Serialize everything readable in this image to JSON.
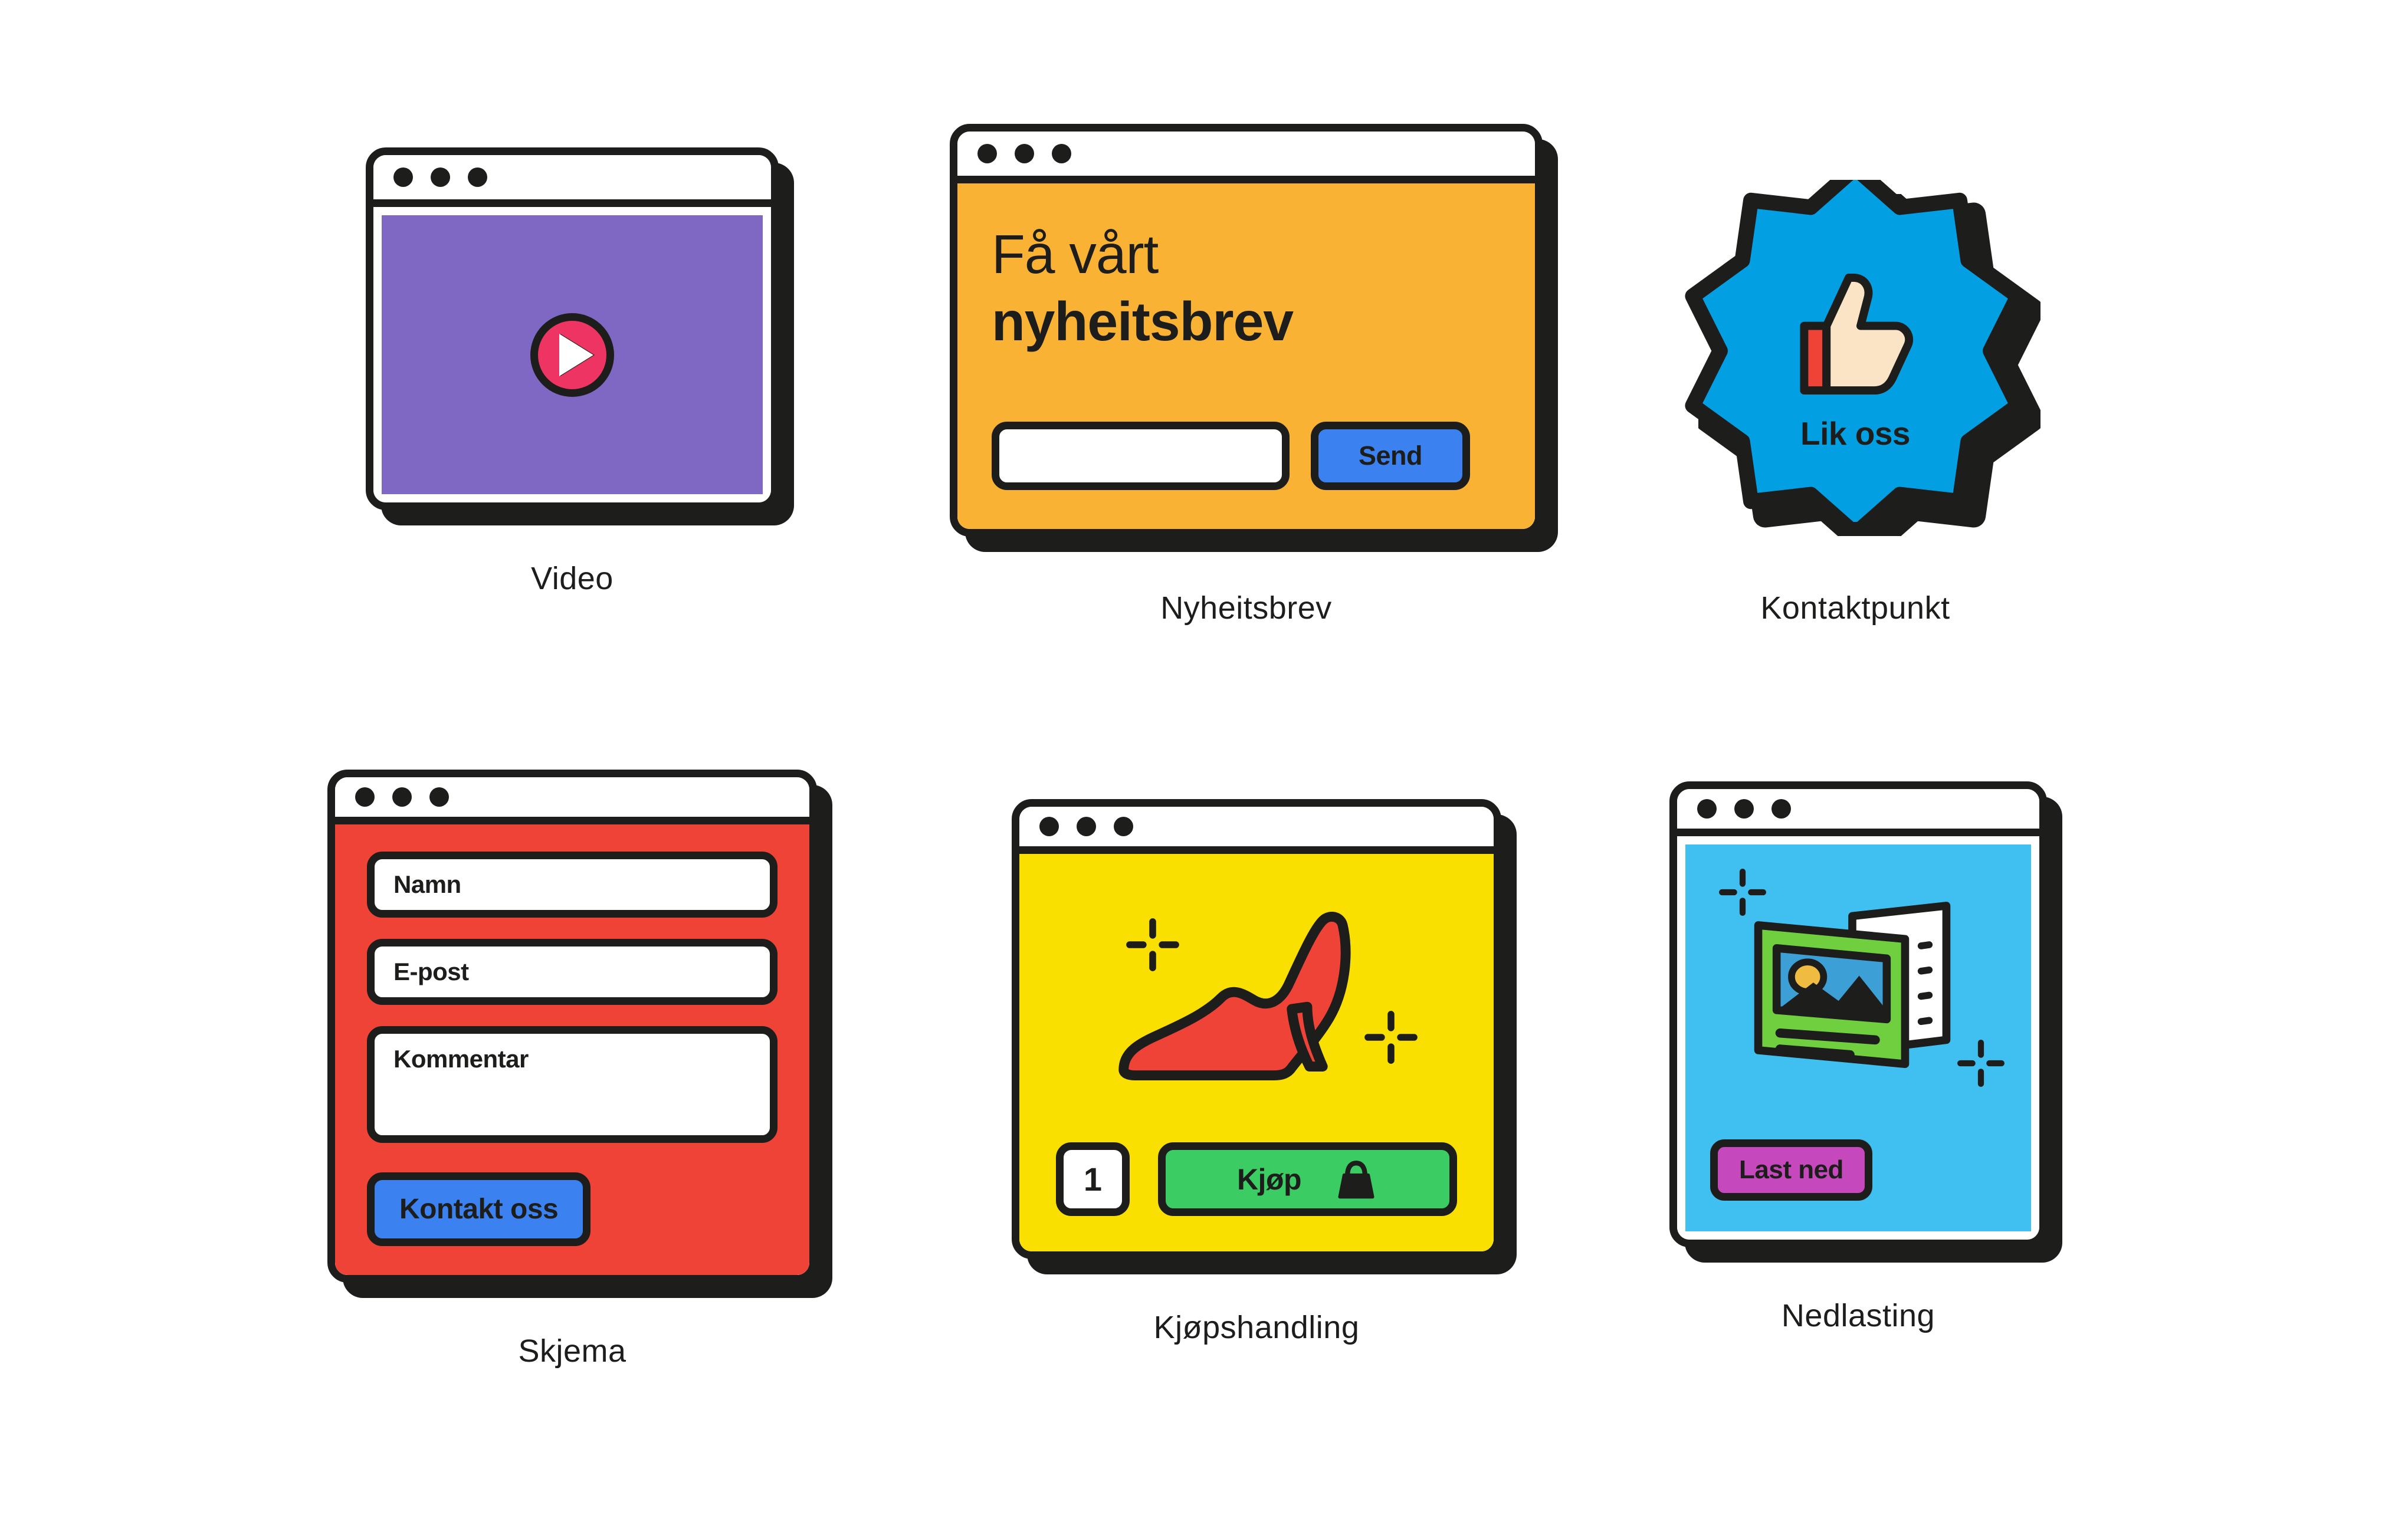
{
  "palette": {
    "ink": "#1d1d1b",
    "purple": "#7f67c4",
    "pink": "#ed3463",
    "orange": "#f9b233",
    "blue": "#3b82f0",
    "badge_blue": "#029fe3",
    "skin": "#fbe4c6",
    "red": "#ef4337",
    "yellow": "#f9e000",
    "green": "#3bcd63",
    "cyan": "#3fc0f0",
    "magenta": "#c549bd",
    "leaf": "#6fcf3f",
    "sun": "#f0bb41",
    "sky": "#3c9fd6",
    "white": "#ffffff"
  },
  "cards": {
    "video": {
      "caption": "Video",
      "window_dots": 3,
      "icons": {
        "play": "play-icon"
      }
    },
    "newsletter": {
      "caption": "Nyheitsbrev",
      "window_dots": 3,
      "heading_line1": "Få vårt",
      "heading_line2": "nyheitsbrev",
      "email_value": "",
      "email_placeholder": "",
      "send_label": "Send"
    },
    "contactpoint": {
      "caption": "Kontaktpunkt",
      "badge_label": "Lik oss",
      "icons": {
        "thumb": "thumbs-up-icon"
      }
    },
    "form": {
      "caption": "Skjema",
      "window_dots": 3,
      "fields": [
        {
          "label": "Namn",
          "value": "",
          "multiline": false
        },
        {
          "label": "E-post",
          "value": "",
          "multiline": false
        },
        {
          "label": "Kommentar",
          "value": "",
          "multiline": true
        }
      ],
      "submit_label": "Kontakt oss"
    },
    "purchase": {
      "caption": "Kjøpshandling",
      "window_dots": 3,
      "quantity": "1",
      "buy_label": "Kjøp",
      "icons": {
        "product": "high-heel-shoe-icon",
        "bag": "shopping-bag-icon",
        "sparkle": "sparkle-icon"
      }
    },
    "download": {
      "caption": "Nedlasting",
      "window_dots": 3,
      "download_label": "Last ned",
      "icons": {
        "brochure": "brochure-image-icon",
        "sparkle": "sparkle-icon"
      }
    }
  }
}
